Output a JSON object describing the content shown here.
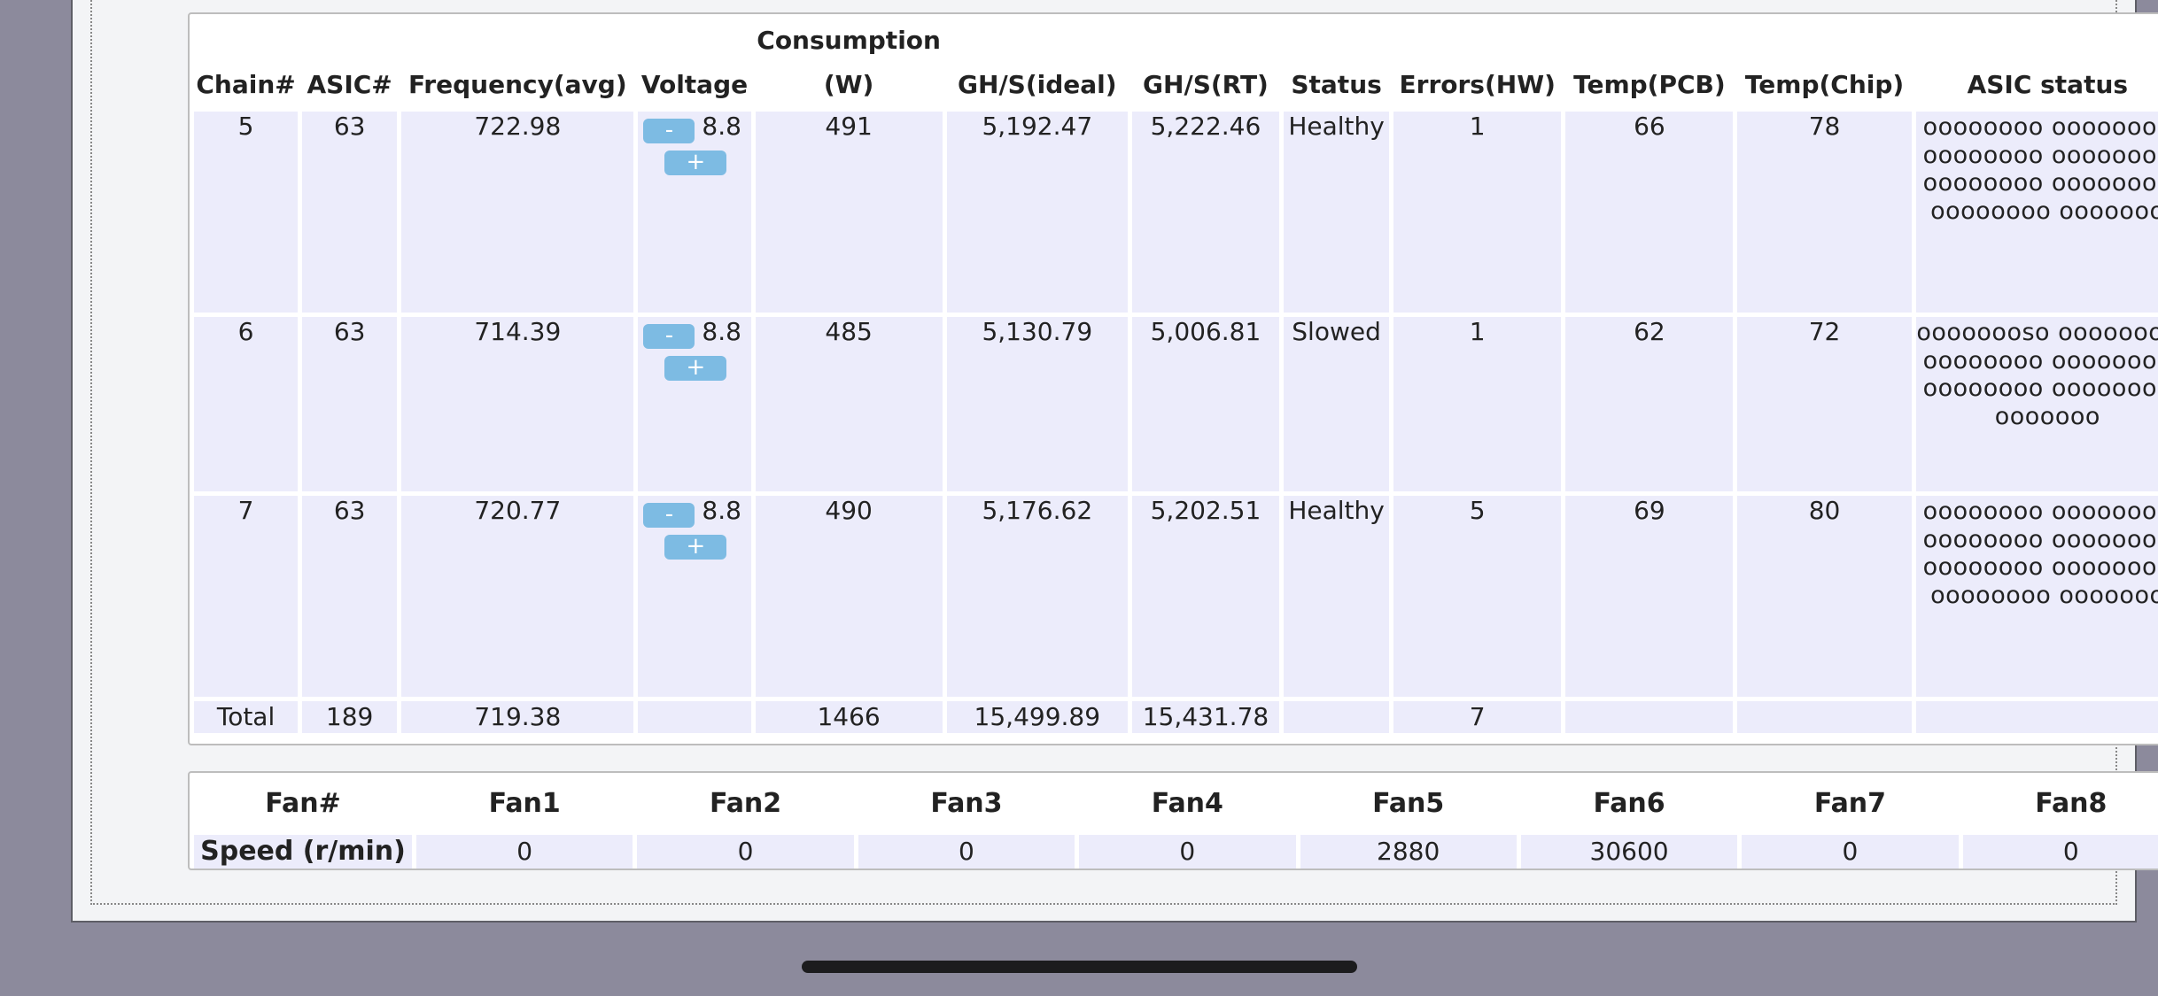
{
  "chains_table": {
    "headers": {
      "chain": "Chain#",
      "asic": "ASIC#",
      "frequency": "Frequency(avg)",
      "voltage": "Voltage",
      "consumption_line1": "Consumption",
      "consumption_line2": "(W)",
      "ghs_ideal": "GH/S(ideal)",
      "ghs_rt": "GH/S(RT)",
      "status": "Status",
      "errors": "Errors(HW)",
      "temp_pcb": "Temp(PCB)",
      "temp_chip": "Temp(Chip)",
      "asic_status": "ASIC status"
    },
    "rows": [
      {
        "chain": "5",
        "asic": "63",
        "frequency": "722.98",
        "voltage": "8.8",
        "minus_label": "-",
        "plus_label": "+",
        "consumption": "491",
        "ghs_ideal": "5,192.47",
        "ghs_rt": "5,222.46",
        "status": "Healthy",
        "errors": "1",
        "temp_pcb": "66",
        "temp_chip": "78",
        "asic_status": "oooooooo oooooooo oooooooo oooooooo oooooooo oooooooo oooooooo ooooooo"
      },
      {
        "chain": "6",
        "asic": "63",
        "frequency": "714.39",
        "voltage": "8.8",
        "minus_label": "-",
        "plus_label": "+",
        "consumption": "485",
        "ghs_ideal": "5,130.79",
        "ghs_rt": "5,006.81",
        "status": "Slowed",
        "errors": "1",
        "temp_pcb": "62",
        "temp_chip": "72",
        "asic_status": "oooooooso oooooooo oooooooo oooooooo oooooooo oooooooo ooooooo"
      },
      {
        "chain": "7",
        "asic": "63",
        "frequency": "720.77",
        "voltage": "8.8",
        "minus_label": "-",
        "plus_label": "+",
        "consumption": "490",
        "ghs_ideal": "5,176.62",
        "ghs_rt": "5,202.51",
        "status": "Healthy",
        "errors": "5",
        "temp_pcb": "69",
        "temp_chip": "80",
        "asic_status": "oooooooo oooooooo oooooooo oooooooo oooooooo oooooooo oooooooo ooooooo"
      }
    ],
    "total": {
      "label": "Total",
      "asic": "189",
      "frequency": "719.38",
      "consumption": "1466",
      "ghs_ideal": "15,499.89",
      "ghs_rt": "15,431.78",
      "errors": "7"
    }
  },
  "fans_table": {
    "header_label": "Fan#",
    "row_label": "Speed (r/min)",
    "fans": [
      {
        "name": "Fan1",
        "speed": "0"
      },
      {
        "name": "Fan2",
        "speed": "0"
      },
      {
        "name": "Fan3",
        "speed": "0"
      },
      {
        "name": "Fan4",
        "speed": "0"
      },
      {
        "name": "Fan5",
        "speed": "2880"
      },
      {
        "name": "Fan6",
        "speed": "30600"
      },
      {
        "name": "Fan7",
        "speed": "0"
      },
      {
        "name": "Fan8",
        "speed": "0"
      }
    ]
  },
  "colors": {
    "cell_background": "#ececfb",
    "button_blue": "#7dbbe3",
    "page_background": "#8c8a9c"
  }
}
